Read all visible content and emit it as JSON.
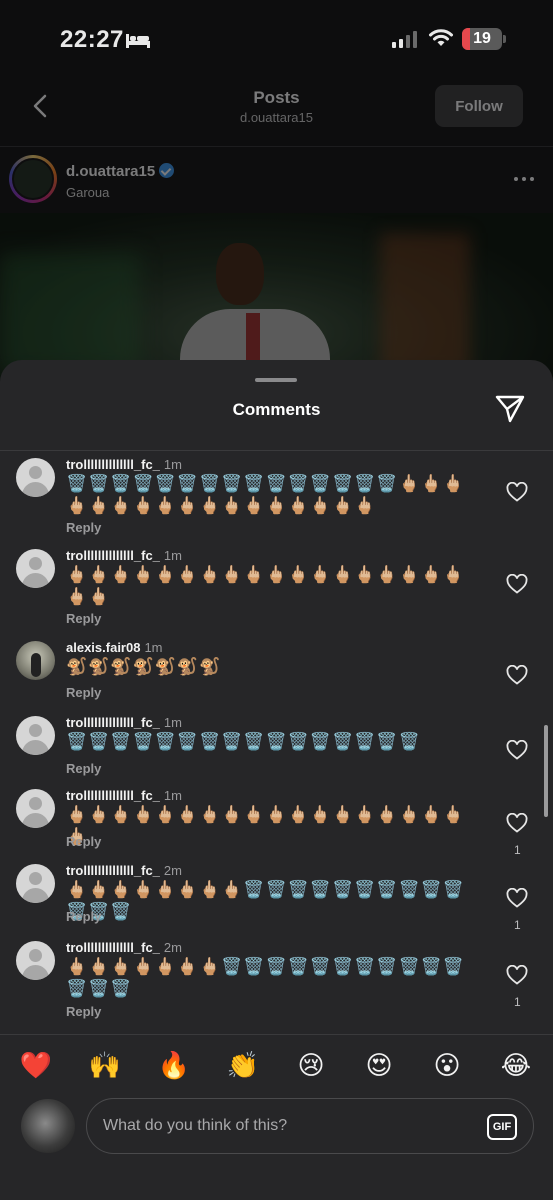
{
  "status_bar": {
    "time": "22:27",
    "battery": "19"
  },
  "header": {
    "title": "Posts",
    "subtitle": "d.ouattara15",
    "follow_label": "Follow"
  },
  "post": {
    "username": "d.ouattara15",
    "location": "Garoua"
  },
  "sheet": {
    "title": "Comments"
  },
  "comments": [
    {
      "username": "trollllllllllllll_fc_",
      "time": "1m",
      "text": "🗑️🗑️🗑️🗑️🗑️🗑️🗑️🗑️🗑️🗑️🗑️🗑️🗑️🗑️🗑️🖕🏼🖕🏼🖕🏼🖕🏼🖕🏼🖕🏼🖕🏼🖕🏼🖕🏼🖕🏼🖕🏼🖕🏼🖕🏼🖕🏼🖕🏼🖕🏼🖕🏼",
      "reply": "Reply",
      "likes": ""
    },
    {
      "username": "trollllllllllllll_fc_",
      "time": "1m",
      "text": "🖕🏼🖕🏼🖕🏼🖕🏼🖕🏼🖕🏼🖕🏼🖕🏼🖕🏼🖕🏼🖕🏼🖕🏼🖕🏼🖕🏼🖕🏼🖕🏼🖕🏼🖕🏼🖕🏼🖕🏼",
      "reply": "Reply",
      "likes": ""
    },
    {
      "username": "alexis.fair08",
      "time": "1m",
      "text": "🐒🐒🐒🐒🐒🐒🐒",
      "reply": "Reply",
      "likes": ""
    },
    {
      "username": "trollllllllllllll_fc_",
      "time": "1m",
      "text": "🗑️🗑️🗑️🗑️🗑️🗑️🗑️🗑️🗑️🗑️🗑️🗑️🗑️🗑️🗑️🗑️",
      "reply": "Reply",
      "likes": ""
    },
    {
      "username": "trollllllllllllll_fc_",
      "time": "1m",
      "text": "🖕🏼🖕🏼🖕🏼🖕🏼🖕🏼🖕🏼🖕🏼🖕🏼🖕🏼🖕🏼🖕🏼🖕🏼🖕🏼🖕🏼🖕🏼🖕🏼🖕🏼🖕🏼🖕🏼",
      "reply": "Reply",
      "likes": "1"
    },
    {
      "username": "trollllllllllllll_fc_",
      "time": "2m",
      "text": "🖕🏼🖕🏼🖕🏼🖕🏼🖕🏼🖕🏼🖕🏼🖕🏼🗑️🗑️🗑️🗑️🗑️🗑️🗑️🗑️🗑️🗑️🗑️🗑️🗑️",
      "reply": "Reply",
      "likes": "1"
    },
    {
      "username": "trollllllllllllll_fc_",
      "time": "2m",
      "text": "🖕🏼🖕🏼🖕🏼🖕🏼🖕🏼🖕🏼🖕🏼🗑️🗑️🗑️🗑️🗑️🗑️🗑️🗑️🗑️🗑️🗑️🗑️🗑️🗑️",
      "reply": "Reply",
      "likes": "1"
    }
  ],
  "quick_reactions": [
    "❤️",
    "🙌",
    "🔥",
    "👏",
    "😢",
    "😍",
    "😮",
    "😂"
  ],
  "composer": {
    "placeholder": "What do you think of this?",
    "gif_label": "GIF"
  },
  "colors": {
    "sheet_bg": "#262628",
    "battery_low": "#e5484d",
    "verified": "#3897f0"
  }
}
